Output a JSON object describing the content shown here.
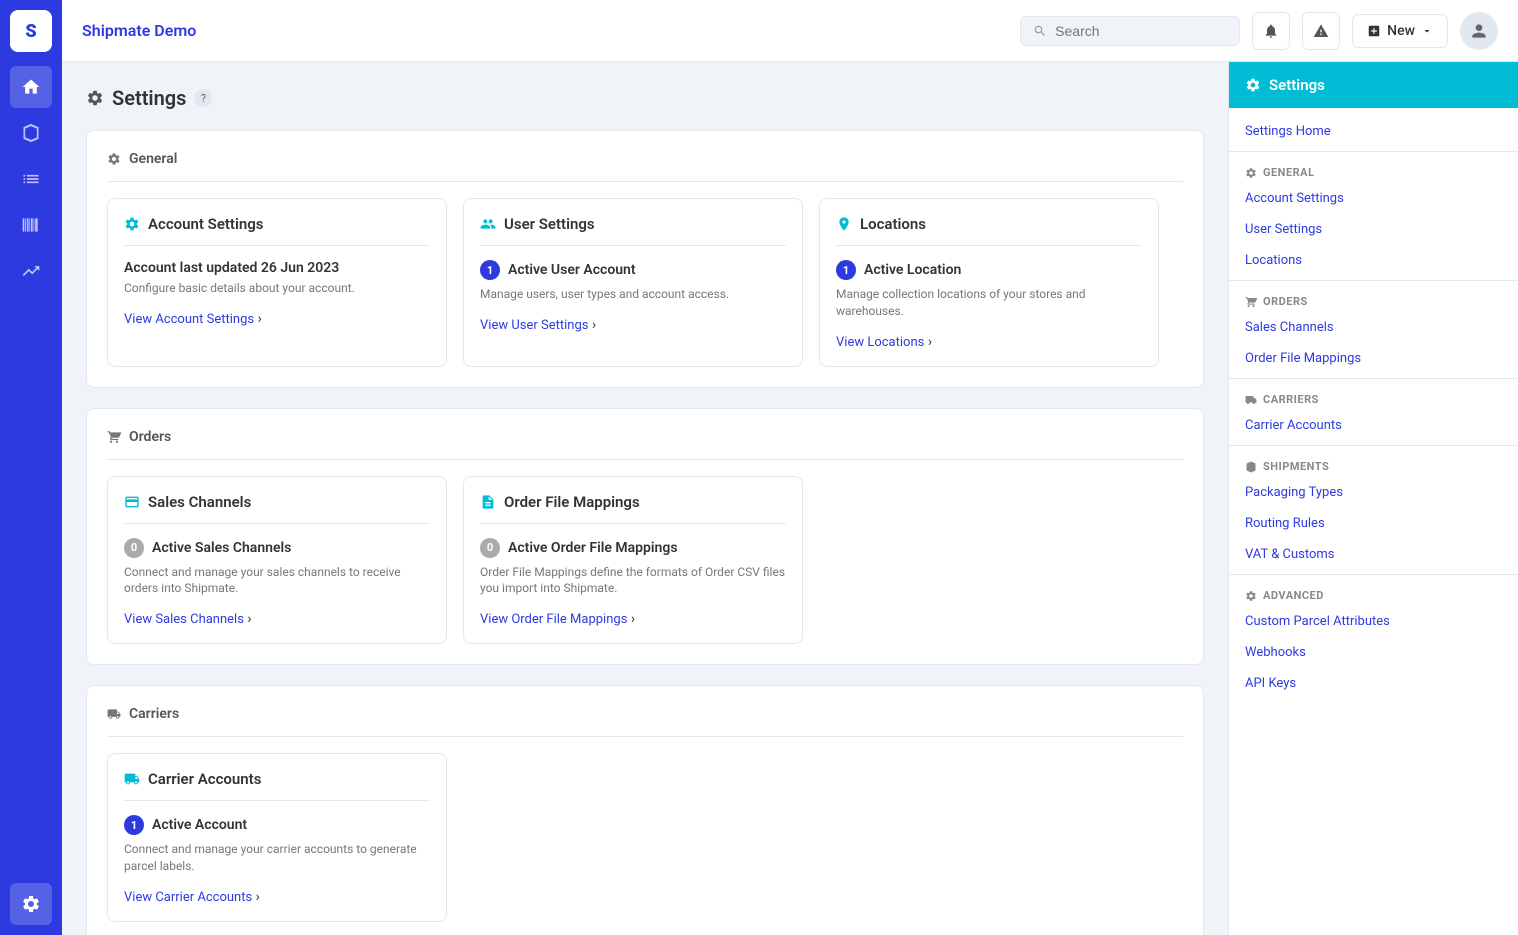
{
  "appTitle": "Shipmate Demo",
  "header": {
    "searchPlaceholder": "Search",
    "newButtonLabel": "New"
  },
  "pageTitle": "Settings",
  "sidebar": {
    "headerLabel": "Settings",
    "settingsHome": "Settings Home",
    "sections": [
      {
        "label": "GENERAL",
        "items": [
          "Account Settings",
          "User Settings",
          "Locations"
        ]
      },
      {
        "label": "ORDERS",
        "items": [
          "Sales Channels",
          "Order File Mappings"
        ]
      },
      {
        "label": "CARRIERS",
        "items": [
          "Carrier Accounts"
        ]
      },
      {
        "label": "SHIPMENTS",
        "items": [
          "Packaging Types",
          "Routing Rules",
          "VAT & Customs"
        ]
      },
      {
        "label": "ADVANCED",
        "items": [
          "Custom Parcel Attributes",
          "Webhooks",
          "API Keys"
        ]
      }
    ]
  },
  "sections": [
    {
      "id": "general",
      "label": "General",
      "cards": [
        {
          "id": "account-settings",
          "title": "Account Settings",
          "updated": "Account last updated 26 Jun 2023",
          "desc": "Configure basic details about your account.",
          "linkLabel": "View Account Settings",
          "statLabel": null,
          "statCount": null,
          "statType": null
        },
        {
          "id": "user-settings",
          "title": "User Settings",
          "updated": null,
          "statCount": "1",
          "statType": "blue",
          "statLabel": "Active User Account",
          "desc": "Manage users, user types and account access.",
          "linkLabel": "View User Settings"
        },
        {
          "id": "locations",
          "title": "Locations",
          "updated": null,
          "statCount": "1",
          "statType": "blue",
          "statLabel": "Active Location",
          "desc": "Manage collection locations of your stores and warehouses.",
          "linkLabel": "View Locations"
        }
      ]
    },
    {
      "id": "orders",
      "label": "Orders",
      "cards": [
        {
          "id": "sales-channels",
          "title": "Sales Channels",
          "updated": null,
          "statCount": "0",
          "statType": "gray",
          "statLabel": "Active Sales Channels",
          "desc": "Connect and manage your sales channels to receive orders into Shipmate.",
          "linkLabel": "View Sales Channels"
        },
        {
          "id": "order-file-mappings",
          "title": "Order File Mappings",
          "updated": null,
          "statCount": "0",
          "statType": "gray",
          "statLabel": "Active Order File Mappings",
          "desc": "Order File Mappings define the formats of Order CSV files you import into Shipmate.",
          "linkLabel": "View Order File Mappings"
        }
      ]
    },
    {
      "id": "carriers",
      "label": "Carriers",
      "cards": [
        {
          "id": "carrier-accounts",
          "title": "Carrier Accounts",
          "updated": null,
          "statCount": "1",
          "statType": "blue",
          "statLabel": "Active Account",
          "desc": "Connect and manage your carrier accounts to generate parcel labels.",
          "linkLabel": "View Carrier Accounts"
        }
      ]
    }
  ]
}
